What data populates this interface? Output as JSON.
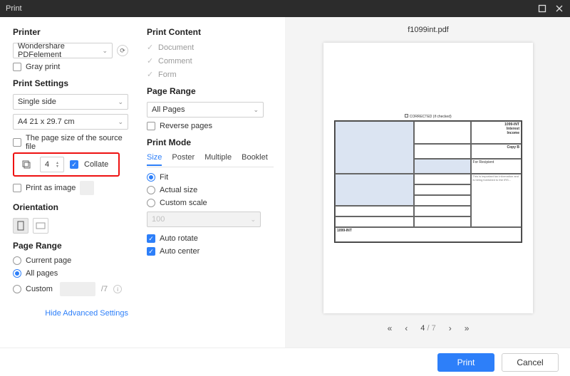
{
  "title": "Print",
  "file": "f1099int.pdf",
  "left": {
    "printer_h": "Printer",
    "printer": "Wondershare PDFelement",
    "gray": "Gray print",
    "settings_h": "Print Settings",
    "duplex": "Single side",
    "paper": "A4 21 x 29.7 cm",
    "srcsize": "The page size of the source file",
    "copies": "4",
    "collate": "Collate",
    "asimage": "Print as image",
    "orient_h": "Orientation",
    "range_h": "Page Range",
    "current": "Current page",
    "all": "All pages",
    "custom": "Custom",
    "hide": "Hide Advanced Settings"
  },
  "mid": {
    "content_h": "Print Content",
    "doc": "Document",
    "comment": "Comment",
    "form": "Form",
    "range_h": "Page Range",
    "allpages": "All Pages",
    "reverse": "Reverse pages",
    "mode_h": "Print Mode",
    "tab_size": "Size",
    "tab_poster": "Poster",
    "tab_multi": "Multiple",
    "tab_book": "Booklet",
    "fit": "Fit",
    "actual": "Actual size",
    "customscale": "Custom scale",
    "autorotate": "Auto rotate",
    "autocenter": "Auto center"
  },
  "pager": {
    "page": "4",
    "total": " / 7"
  },
  "footer": {
    "print": "Print",
    "cancel": "Cancel"
  },
  "form": {
    "title": "1099-INT",
    "interest": "Interest",
    "income": "Income",
    "copy": "Copy B",
    "recipient": "For Recipient",
    "corrected": "CORRECTED (if checked)",
    "bottom": "1099-INT"
  }
}
